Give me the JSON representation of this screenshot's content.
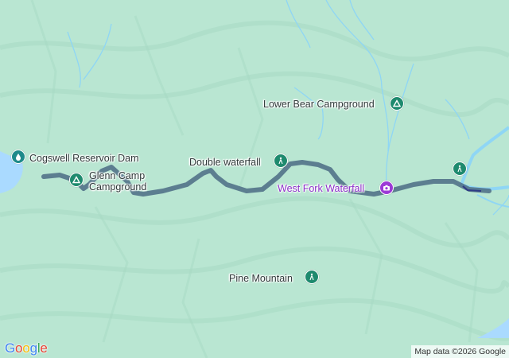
{
  "map": {
    "terrain_color": "#b9e6d2",
    "water_color": "#aadaff",
    "river_color": "#8fd6f5",
    "route_color": "#4f6f86",
    "places": [
      {
        "key": "cogswell",
        "label": "Cogswell Reservoir Dam",
        "icon": "water-icon"
      },
      {
        "key": "glenn",
        "label": "Glenn Camp",
        "label2": "Campground",
        "icon": "campground-icon"
      },
      {
        "key": "double",
        "label": "Double waterfall",
        "icon": "hiking-icon"
      },
      {
        "key": "lower_bear",
        "label": "Lower Bear Campground",
        "icon": "campground-icon"
      },
      {
        "key": "west_fork",
        "label": "West Fork Waterfall",
        "icon": "camera-icon",
        "color": "#8b2fc9"
      },
      {
        "key": "pine",
        "label": "Pine Mountain",
        "icon": "hiking-icon"
      },
      {
        "key": "east_trail",
        "label": "",
        "icon": "hiking-icon"
      }
    ],
    "logo": {
      "letters": [
        "G",
        "o",
        "o",
        "g",
        "l",
        "e"
      ],
      "colors": [
        "#4285F4",
        "#EA4335",
        "#FBBC05",
        "#4285F4",
        "#34A853",
        "#EA4335"
      ]
    },
    "attribution": "Map data ©2026 Google"
  }
}
